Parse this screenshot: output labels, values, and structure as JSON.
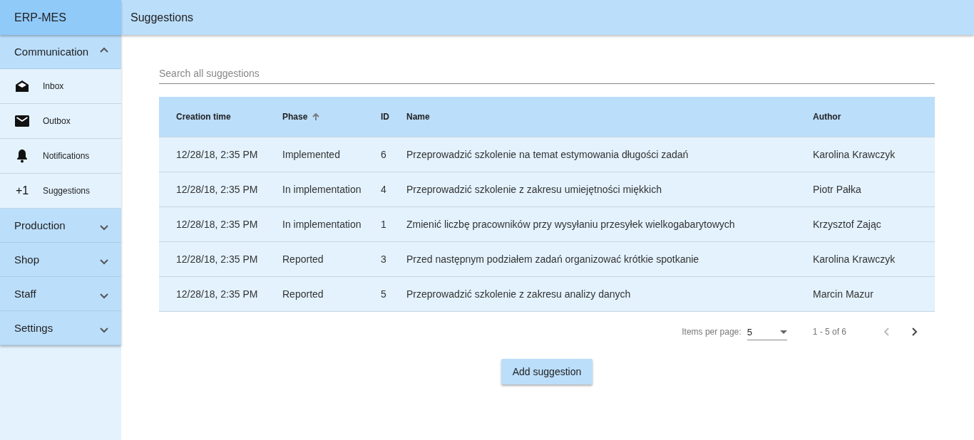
{
  "app": {
    "title": "ERP-MES"
  },
  "header": {
    "title": "Suggestions"
  },
  "sidebar": {
    "sections": [
      {
        "label": "Communication",
        "expanded": true,
        "items": [
          {
            "label": "Inbox",
            "kind": "inbox"
          },
          {
            "label": "Outbox",
            "kind": "outbox"
          },
          {
            "label": "Notifications",
            "kind": "bell"
          },
          {
            "label": "Suggestions",
            "kind": "text",
            "icon_text": "+1"
          }
        ]
      },
      {
        "label": "Production",
        "expanded": false
      },
      {
        "label": "Shop",
        "expanded": false
      },
      {
        "label": "Staff",
        "expanded": false
      },
      {
        "label": "Settings",
        "expanded": false
      }
    ]
  },
  "search": {
    "placeholder": "Search all suggestions"
  },
  "table": {
    "columns": [
      {
        "label": "Creation time",
        "sorted": false
      },
      {
        "label": "Phase",
        "sorted": true
      },
      {
        "label": "ID",
        "sorted": false
      },
      {
        "label": "Name",
        "sorted": false
      },
      {
        "label": "Author",
        "sorted": false
      }
    ],
    "rows": [
      [
        "12/28/18, 2:35 PM",
        "Implemented",
        "6",
        "Przeprowadzić szkolenie na temat estymowania długości zadań",
        "Karolina Krawczyk"
      ],
      [
        "12/28/18, 2:35 PM",
        "In implementation",
        "4",
        "Przeprowadzić szkolenie z zakresu umiejętności miękkich",
        "Piotr Pałka"
      ],
      [
        "12/28/18, 2:35 PM",
        "In implementation",
        "1",
        "Zmienić liczbę pracowników przy wysyłaniu przesyłek wielkogabarytowych",
        "Krzysztof Zając"
      ],
      [
        "12/28/18, 2:35 PM",
        "Reported",
        "3",
        "Przed następnym podziałem zadań organizować krótkie spotkanie",
        "Karolina Krawczyk"
      ],
      [
        "12/28/18, 2:35 PM",
        "Reported",
        "5",
        "Przeprowadzić szkolenie z zakresu analizy danych",
        "Marcin Mazur"
      ]
    ]
  },
  "paginator": {
    "label": "Items per page:",
    "page_size": "5",
    "range": "1 - 5 of 6",
    "prev_disabled": true,
    "next_disabled": false
  },
  "add_button": "Add suggestion"
}
